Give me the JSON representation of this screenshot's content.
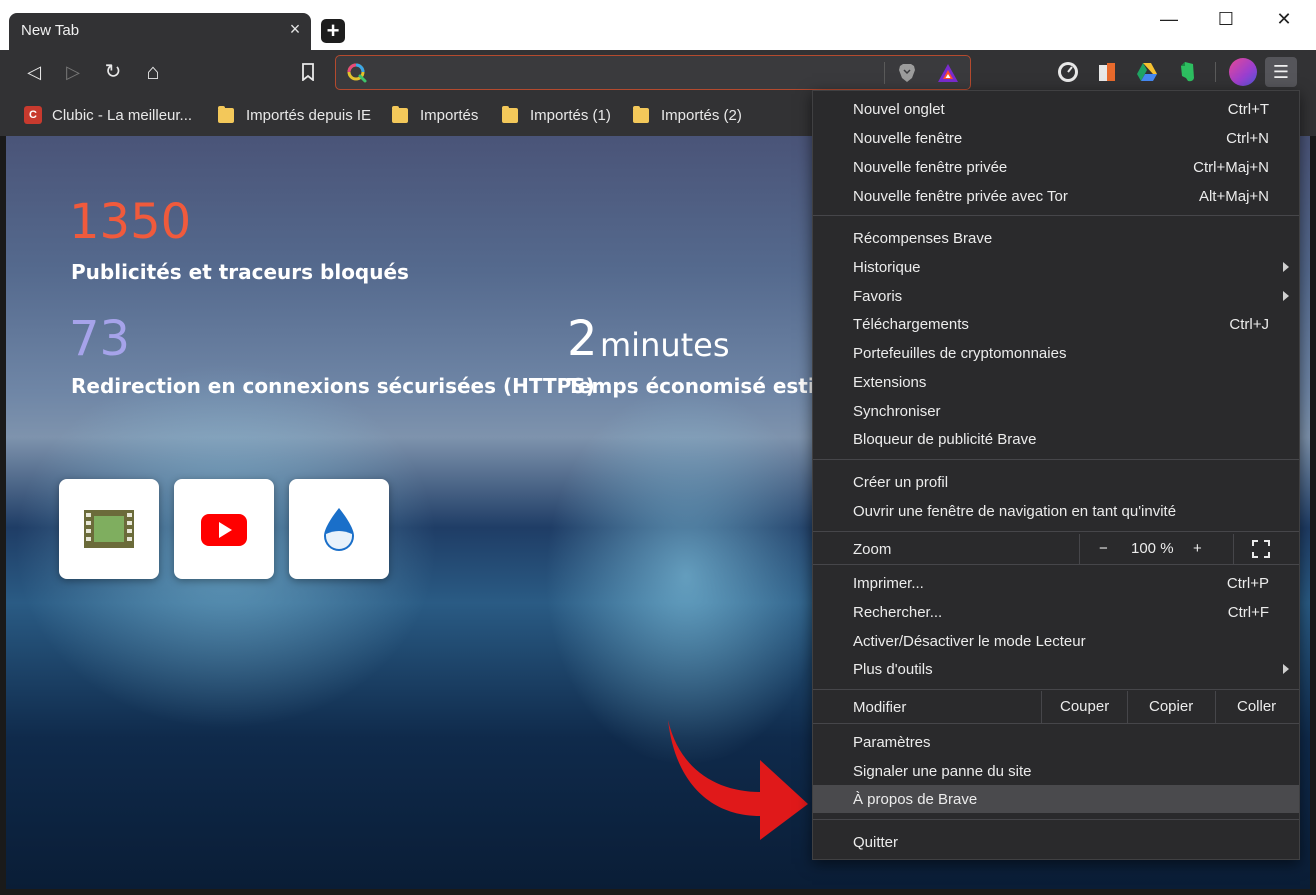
{
  "tab": {
    "title": "New Tab",
    "close": "×",
    "new_tab": "+"
  },
  "window": {
    "minimize": "—",
    "maximize": "☐",
    "close": "✕"
  },
  "toolbar": {
    "back": "◁",
    "forward": "▷",
    "reload": "↻",
    "home": "⌂",
    "bookmark": "bookmark-icon",
    "address_value": "",
    "menu": "☰"
  },
  "bookmarks": [
    {
      "label": "Clubic - La meilleur...",
      "icon": "C"
    },
    {
      "label": "Importés depuis IE"
    },
    {
      "label": "Importés"
    },
    {
      "label": "Importés (1)"
    },
    {
      "label": "Importés (2)"
    }
  ],
  "stats": {
    "ads_count": "1350",
    "ads_label": "Publicités et traceurs bloqués",
    "https_count": "73",
    "https_label": "Redirection en connexions sécurisées (HTTPS)",
    "time_value": "2",
    "time_unit": "minutes",
    "time_label": "Temps économisé estim"
  },
  "colors": {
    "ads": "#f05a3c",
    "https": "#a6a3ea",
    "accent": "#b44a2e",
    "arrow": "#e0191a"
  },
  "tiles": [
    "film-icon",
    "youtube-icon",
    "water-drop-icon"
  ],
  "menu": {
    "items": [
      {
        "label": "Nouvel onglet",
        "shortcut": "Ctrl+T"
      },
      {
        "label": "Nouvelle fenêtre",
        "shortcut": "Ctrl+N"
      },
      {
        "label": "Nouvelle fenêtre privée",
        "shortcut": "Ctrl+Maj+N"
      },
      {
        "label": "Nouvelle fenêtre privée avec Tor",
        "shortcut": "Alt+Maj+N"
      },
      {
        "label": "Récompenses Brave",
        "shortcut": ""
      },
      {
        "label": "Historique",
        "shortcut": ""
      },
      {
        "label": "Favoris",
        "shortcut": ""
      },
      {
        "label": "Téléchargements",
        "shortcut": "Ctrl+J"
      },
      {
        "label": "Portefeuilles de cryptomonnaies",
        "shortcut": ""
      },
      {
        "label": "Extensions",
        "shortcut": ""
      },
      {
        "label": "Synchroniser",
        "shortcut": ""
      },
      {
        "label": "Bloqueur de publicité Brave",
        "shortcut": ""
      },
      {
        "label": "Créer un profil",
        "shortcut": ""
      },
      {
        "label": "Ouvrir une fenêtre de navigation en tant qu'invité",
        "shortcut": ""
      },
      {
        "label": "Imprimer...",
        "shortcut": "Ctrl+P"
      },
      {
        "label": "Rechercher...",
        "shortcut": "Ctrl+F"
      },
      {
        "label": "Activer/Désactiver le mode Lecteur",
        "shortcut": ""
      },
      {
        "label": "Plus d'outils",
        "shortcut": ""
      },
      {
        "label": "Paramètres",
        "shortcut": ""
      },
      {
        "label": "Signaler une panne du site",
        "shortcut": ""
      },
      {
        "label": "À propos de Brave",
        "shortcut": ""
      },
      {
        "label": "Quitter",
        "shortcut": ""
      }
    ],
    "zoom": {
      "label": "Zoom",
      "minus": "−",
      "value": "100 %",
      "plus": "+"
    },
    "edit": {
      "label": "Modifier",
      "cut": "Couper",
      "copy": "Copier",
      "paste": "Coller"
    }
  }
}
